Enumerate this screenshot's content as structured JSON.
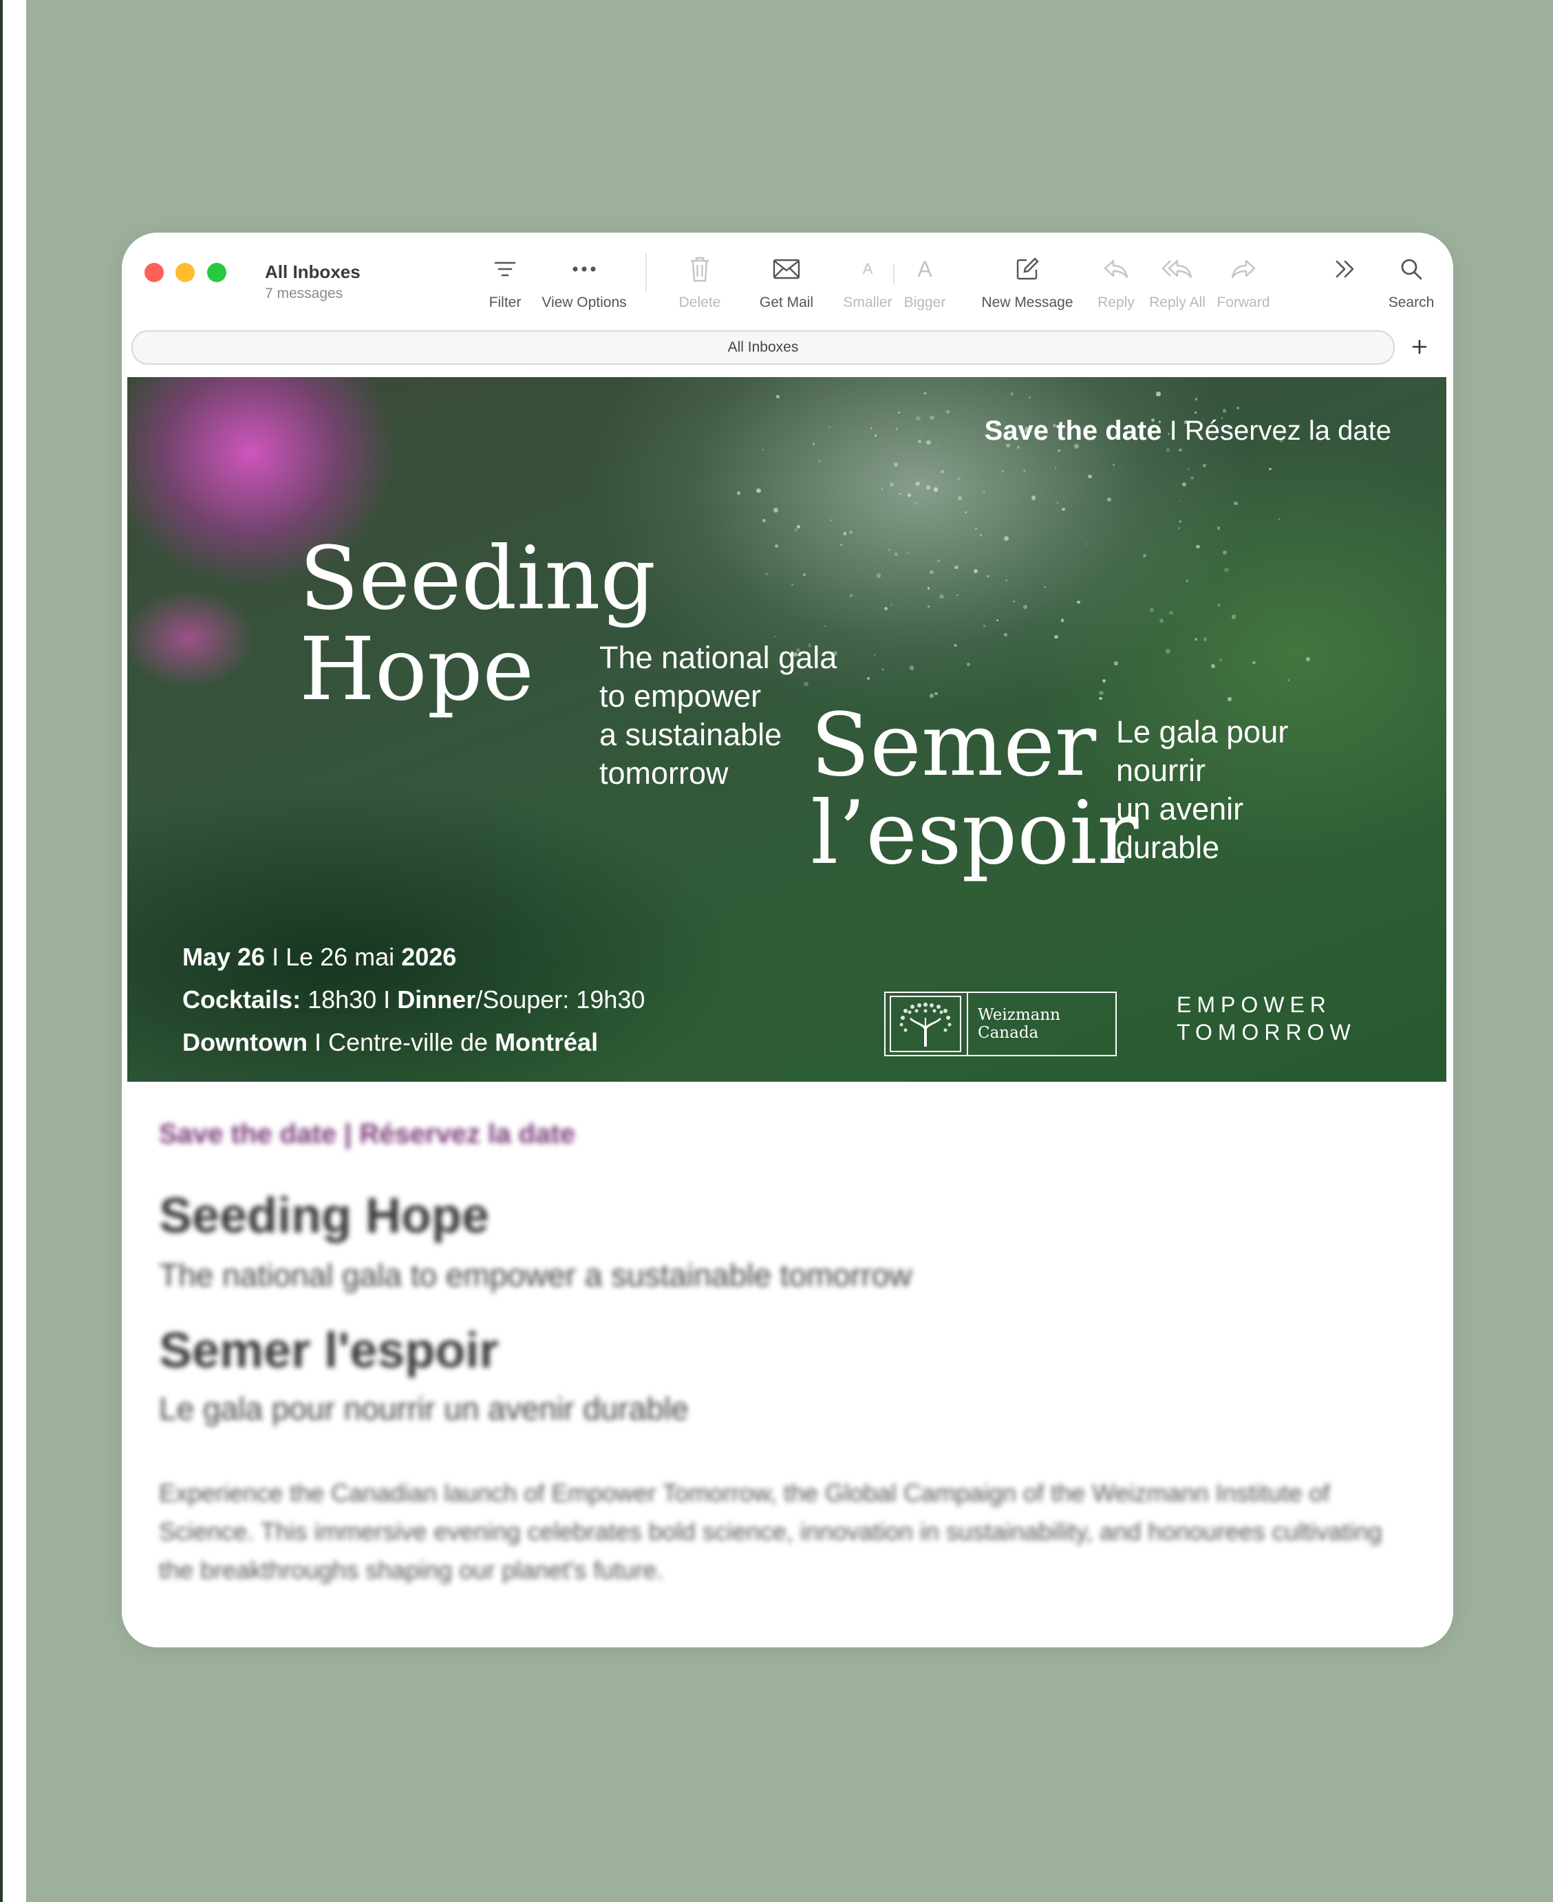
{
  "window": {
    "mailbox_title": "All Inboxes",
    "message_count": "7 messages"
  },
  "toolbar": {
    "filter": "Filter",
    "view_options": "View Options",
    "delete": "Delete",
    "get_mail": "Get Mail",
    "smaller": "Smaller",
    "bigger": "Bigger",
    "font_small_glyph": "A",
    "font_big_glyph": "A",
    "new_message": "New Message",
    "reply": "Reply",
    "reply_all": "Reply All",
    "forward": "Forward",
    "search": "Search"
  },
  "tab": {
    "label": "All Inboxes"
  },
  "banner": {
    "save_bold": "Save the date",
    "save_rest": " I Réservez la date",
    "title_en_1": "Seeding",
    "title_en_2": "Hope",
    "sub_en": [
      "The national gala",
      "to empower",
      "a sustainable",
      "tomorrow"
    ],
    "title_fr_1": "Semer",
    "title_fr_2": "l’espoir",
    "sub_fr": [
      "Le gala pour",
      "nourrir",
      "un avenir",
      "durable"
    ],
    "date_bold1": "May 26",
    "date_mid": " I Le 26 mai ",
    "date_bold2": "2026",
    "cocktails_bold": "Cocktails:",
    "cocktails_time": " 18h30 I ",
    "dinner_bold": "Dinner",
    "dinner_rest": "/Souper: 19h30",
    "place_bold1": "Downtown",
    "place_mid": " I Centre-ville de ",
    "place_bold2": "Montréal",
    "logo_line1": "Weizmann",
    "logo_line2": "Canada",
    "empower_line1": "EMPOWER",
    "empower_line2": "TOMORROW"
  },
  "body": {
    "save": "Save the date | Réservez la date",
    "seed": "Seeding Hope",
    "sub_en": "The national gala to empower a sustainable tomorrow",
    "semer": "Semer l'espoir",
    "sub_fr": "Le gala pour nourrir un avenir durable",
    "paragraph": "Experience the Canadian launch of Empower Tomorrow, the Global Campaign of the Weizmann Institute of Science. This immersive evening celebrates bold science, innovation in sustainability, and honourees cultivating the breakthroughs shaping our planet's future."
  },
  "colors": {
    "background": "#9cb09b",
    "close": "#fe5f57",
    "minimize": "#febc2e",
    "zoom": "#28c840",
    "body_heading_accent": "#7a3a78"
  }
}
